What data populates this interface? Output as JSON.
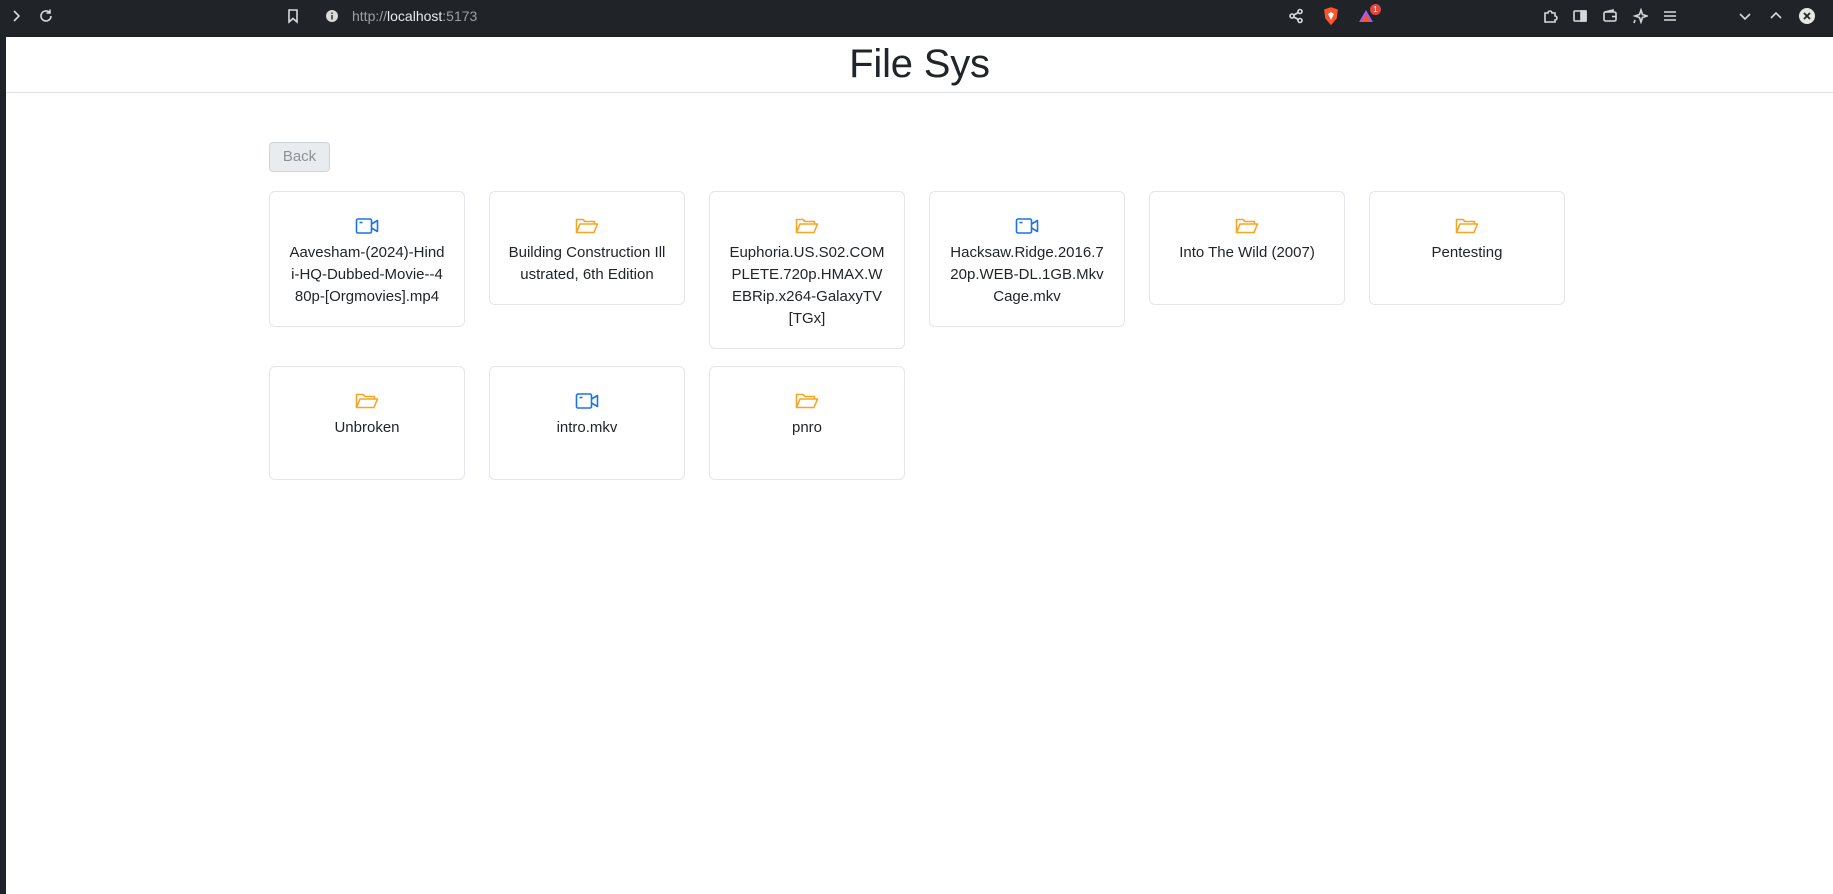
{
  "browser": {
    "url_scheme": "http://",
    "url_host": "localhost",
    "url_port": ":5173",
    "notification_count": "1"
  },
  "app": {
    "title": "File Sys",
    "back_label": "Back"
  },
  "colors": {
    "folder": "#f5a623",
    "video": "#1a73e8"
  },
  "items": [
    {
      "name": "Aavesham-(2024)-Hindi-HQ-Dubbed-Movie--480p-[Orgmovies].mp4",
      "type": "video",
      "icon": "video-icon"
    },
    {
      "name": "Building Construction Illustrated, 6th Edition",
      "type": "folder",
      "icon": "folder-open-icon"
    },
    {
      "name": "Euphoria.US.S02.COMPLETE.720p.HMAX.WEBRip.x264-GalaxyTV[TGx]",
      "type": "folder",
      "icon": "folder-open-icon"
    },
    {
      "name": "Hacksaw.Ridge.2016.720p.WEB-DL.1GB.MkvCage.mkv",
      "type": "video",
      "icon": "video-icon"
    },
    {
      "name": "Into The Wild (2007)",
      "type": "folder",
      "icon": "folder-open-icon"
    },
    {
      "name": "Pentesting",
      "type": "folder",
      "icon": "folder-open-icon"
    },
    {
      "name": "Unbroken",
      "type": "folder",
      "icon": "folder-open-icon"
    },
    {
      "name": "intro.mkv",
      "type": "video",
      "icon": "video-icon"
    },
    {
      "name": "pnro",
      "type": "folder",
      "icon": "folder-open-icon"
    }
  ]
}
